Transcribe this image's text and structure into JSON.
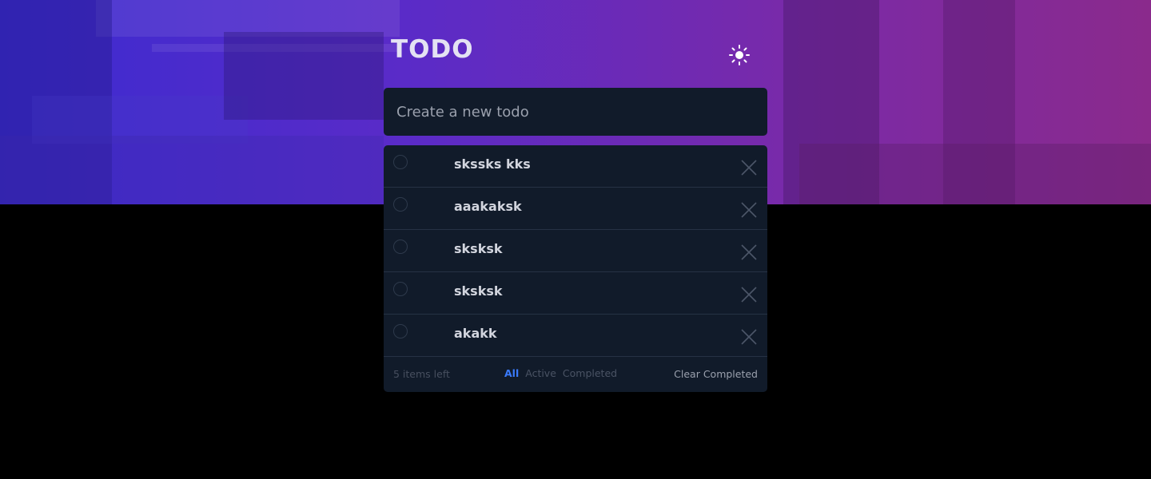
{
  "app": {
    "title": "TODO"
  },
  "theme_toggle": {
    "icon": "sun-icon"
  },
  "new_todo": {
    "placeholder": "Create a new todo",
    "value": ""
  },
  "todos": [
    {
      "text": "skssks kks",
      "completed": false
    },
    {
      "text": "aaakaksk",
      "completed": false
    },
    {
      "text": "sksksk",
      "completed": false
    },
    {
      "text": "sksksk",
      "completed": false
    },
    {
      "text": "akakk",
      "completed": false
    }
  ],
  "footer": {
    "items_left": "5 items left",
    "filters": {
      "all": "All",
      "active": "Active",
      "completed": "Completed"
    },
    "clear_completed": "Clear Completed"
  },
  "colors": {
    "accent": "#3a7bfd",
    "card": "#111b2a",
    "background": "#000000"
  }
}
